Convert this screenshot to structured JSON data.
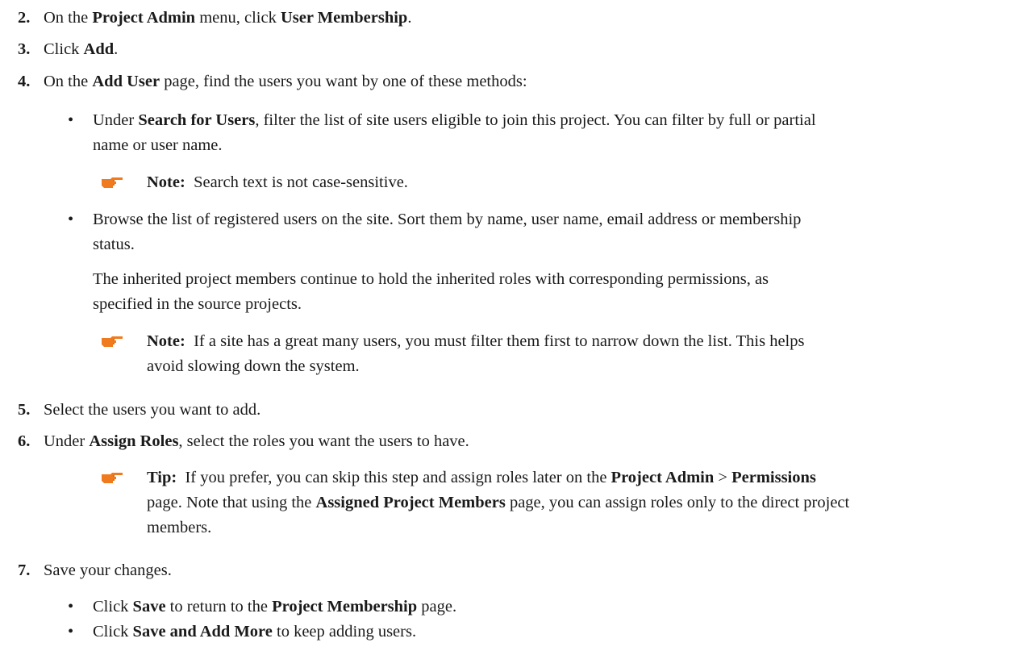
{
  "steps": [
    {
      "num": "2.",
      "parts": [
        {
          "t": "On the "
        },
        {
          "b": "Project Admin"
        },
        {
          "t": " menu, click "
        },
        {
          "b": "User Membership"
        },
        {
          "t": "."
        }
      ]
    },
    {
      "num": "3.",
      "parts": [
        {
          "t": "Click "
        },
        {
          "b": "Add"
        },
        {
          "t": "."
        }
      ]
    },
    {
      "num": "4.",
      "parts": [
        {
          "t": "On the "
        },
        {
          "b": "Add User"
        },
        {
          "t": " page, find the users you want by one of these methods:"
        }
      ]
    },
    {
      "num": "5.",
      "parts": [
        {
          "t": "Select the users you want to add."
        }
      ]
    },
    {
      "num": "6.",
      "parts": [
        {
          "t": "Under "
        },
        {
          "b": "Assign Roles"
        },
        {
          "t": ", select the roles you want the users to have."
        }
      ]
    },
    {
      "num": "7.",
      "parts": [
        {
          "t": "Save your changes."
        }
      ]
    }
  ],
  "bullet_char": "•",
  "step4_bullets": [
    {
      "lines": [
        [
          {
            "t": "Under "
          },
          {
            "b": "Search for Users"
          },
          {
            "t": ", filter the list of site users eligible to join this project. You can filter by full or partial"
          }
        ],
        [
          {
            "t": "name or user name."
          }
        ]
      ]
    },
    {
      "lines": [
        [
          {
            "t": "Browse the list of registered users on the site. Sort them by name, user name, email address or membership"
          }
        ],
        [
          {
            "t": "status."
          }
        ]
      ]
    }
  ],
  "inherited_para": {
    "lines": [
      [
        {
          "t": "The inherited project members continue to hold the inherited roles with corresponding permissions, as"
        }
      ],
      [
        {
          "t": "specified in the source projects."
        }
      ]
    ]
  },
  "notes": [
    {
      "lines": [
        [
          {
            "b": "Note:"
          },
          {
            "t": "  Search text is not case-sensitive."
          }
        ]
      ]
    },
    {
      "lines": [
        [
          {
            "b": "Note:"
          },
          {
            "t": "  If a site has a great many users, you must filter them first to narrow down the list. This helps"
          }
        ],
        [
          {
            "t": "avoid slowing down the system."
          }
        ]
      ]
    },
    {
      "lines": [
        [
          {
            "b": "Tip:"
          },
          {
            "t": "  If you prefer, you can skip this step and assign roles later on the "
          },
          {
            "b": "Project Admin"
          },
          {
            "t": " > "
          },
          {
            "b": "Permissions"
          }
        ],
        [
          {
            "t": "page. Note that using the "
          },
          {
            "b": "Assigned Project Members"
          },
          {
            "t": " page, you can assign roles only to the direct project"
          }
        ],
        [
          {
            "t": "members."
          }
        ]
      ]
    }
  ],
  "step7_bullets": [
    {
      "lines": [
        [
          {
            "t": "Click "
          },
          {
            "b": "Save"
          },
          {
            "t": " to return to the "
          },
          {
            "b": "Project Membership"
          },
          {
            "t": " page."
          }
        ]
      ]
    },
    {
      "lines": [
        [
          {
            "t": "Click "
          },
          {
            "b": "Save and Add More"
          },
          {
            "t": " to keep adding users."
          }
        ]
      ]
    }
  ],
  "colors": {
    "text": "#1a1a1a",
    "hand_icon": "#f07a1e"
  },
  "icons": {
    "note": "pointing-hand-icon"
  }
}
